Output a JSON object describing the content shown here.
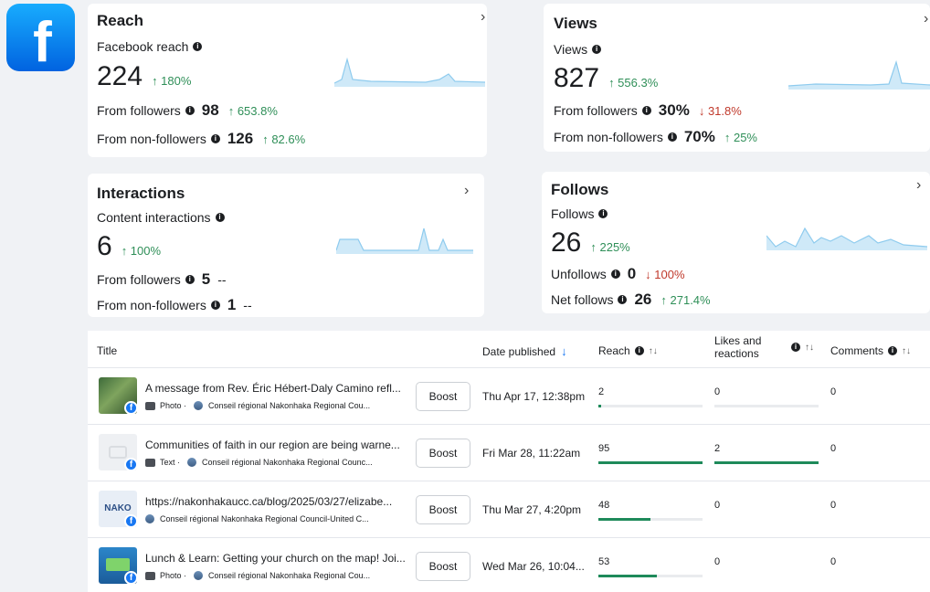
{
  "app": {
    "logo_letter": "f"
  },
  "colors": {
    "brand": "#1877f2",
    "up": "#2f8f58",
    "down": "#c0392b",
    "spark": "#a8d8f0",
    "bar": "#1e8a5a"
  },
  "reach": {
    "title": "Reach",
    "label": "Facebook reach",
    "value": "224",
    "change": "↑ 180%",
    "followers_label": "From followers",
    "followers_value": "98",
    "followers_change": "↑ 653.8%",
    "nonfollowers_label": "From non-followers",
    "nonfollowers_value": "126",
    "nonfollowers_change": "↑ 82.6%"
  },
  "views": {
    "title": "Views",
    "label": "Views",
    "value": "827",
    "change": "↑ 556.3%",
    "followers_label": "From followers",
    "followers_value": "30%",
    "followers_change": "↓ 31.8%",
    "nonfollowers_label": "From non-followers",
    "nonfollowers_value": "70%",
    "nonfollowers_change": "↑ 25%"
  },
  "interactions": {
    "title": "Interactions",
    "label": "Content interactions",
    "value": "6",
    "change": "↑ 100%",
    "followers_label": "From followers",
    "followers_value": "5",
    "followers_change": "--",
    "nonfollowers_label": "From non-followers",
    "nonfollowers_value": "1",
    "nonfollowers_change": "--"
  },
  "follows": {
    "title": "Follows",
    "label": "Follows",
    "value": "26",
    "change": "↑ 225%",
    "unfollows_label": "Unfollows",
    "unfollows_value": "0",
    "unfollows_change": "↓ 100%",
    "net_label": "Net follows",
    "net_value": "26",
    "net_change": "↑ 271.4%"
  },
  "table": {
    "columns": {
      "title": "Title",
      "date": "Date published",
      "reach": "Reach",
      "likes": "Likes and reactions",
      "comments": "Comments"
    },
    "boost_label": "Boost",
    "rows": [
      {
        "title": "A message from Rev. Éric Hébert-Daly Camino refl...",
        "type": "Photo ·",
        "page": "Conseil régional Nakonhaka Regional Cou...",
        "date": "Thu Apr 17, 12:38pm",
        "reach": "2",
        "reach_fraction": 0.02,
        "likes": "0",
        "likes_fraction": 0,
        "comments": "0"
      },
      {
        "title": "Communities of faith in our region are being warne...",
        "type": "Text ·",
        "page": "Conseil régional Nakonhaka Regional Counc...",
        "date": "Fri Mar 28, 11:22am",
        "reach": "95",
        "reach_fraction": 1.0,
        "likes": "2",
        "likes_fraction": 1.0,
        "comments": "0"
      },
      {
        "title": "https://nakonhakaucc.ca/blog/2025/03/27/elizabe...",
        "type": "",
        "page": "Conseil régional Nakonhaka Regional Council-United C...",
        "date": "Thu Mar 27, 4:20pm",
        "reach": "48",
        "reach_fraction": 0.5,
        "likes": "0",
        "likes_fraction": 0,
        "comments": "0"
      },
      {
        "title": "Lunch & Learn: Getting your church on the map! Joi...",
        "type": "Photo ·",
        "page": "Conseil régional Nakonhaka Regional Cou...",
        "date": "Wed Mar 26, 10:04...",
        "reach": "53",
        "reach_fraction": 0.56,
        "likes": "0",
        "likes_fraction": 0,
        "comments": "0"
      }
    ]
  }
}
